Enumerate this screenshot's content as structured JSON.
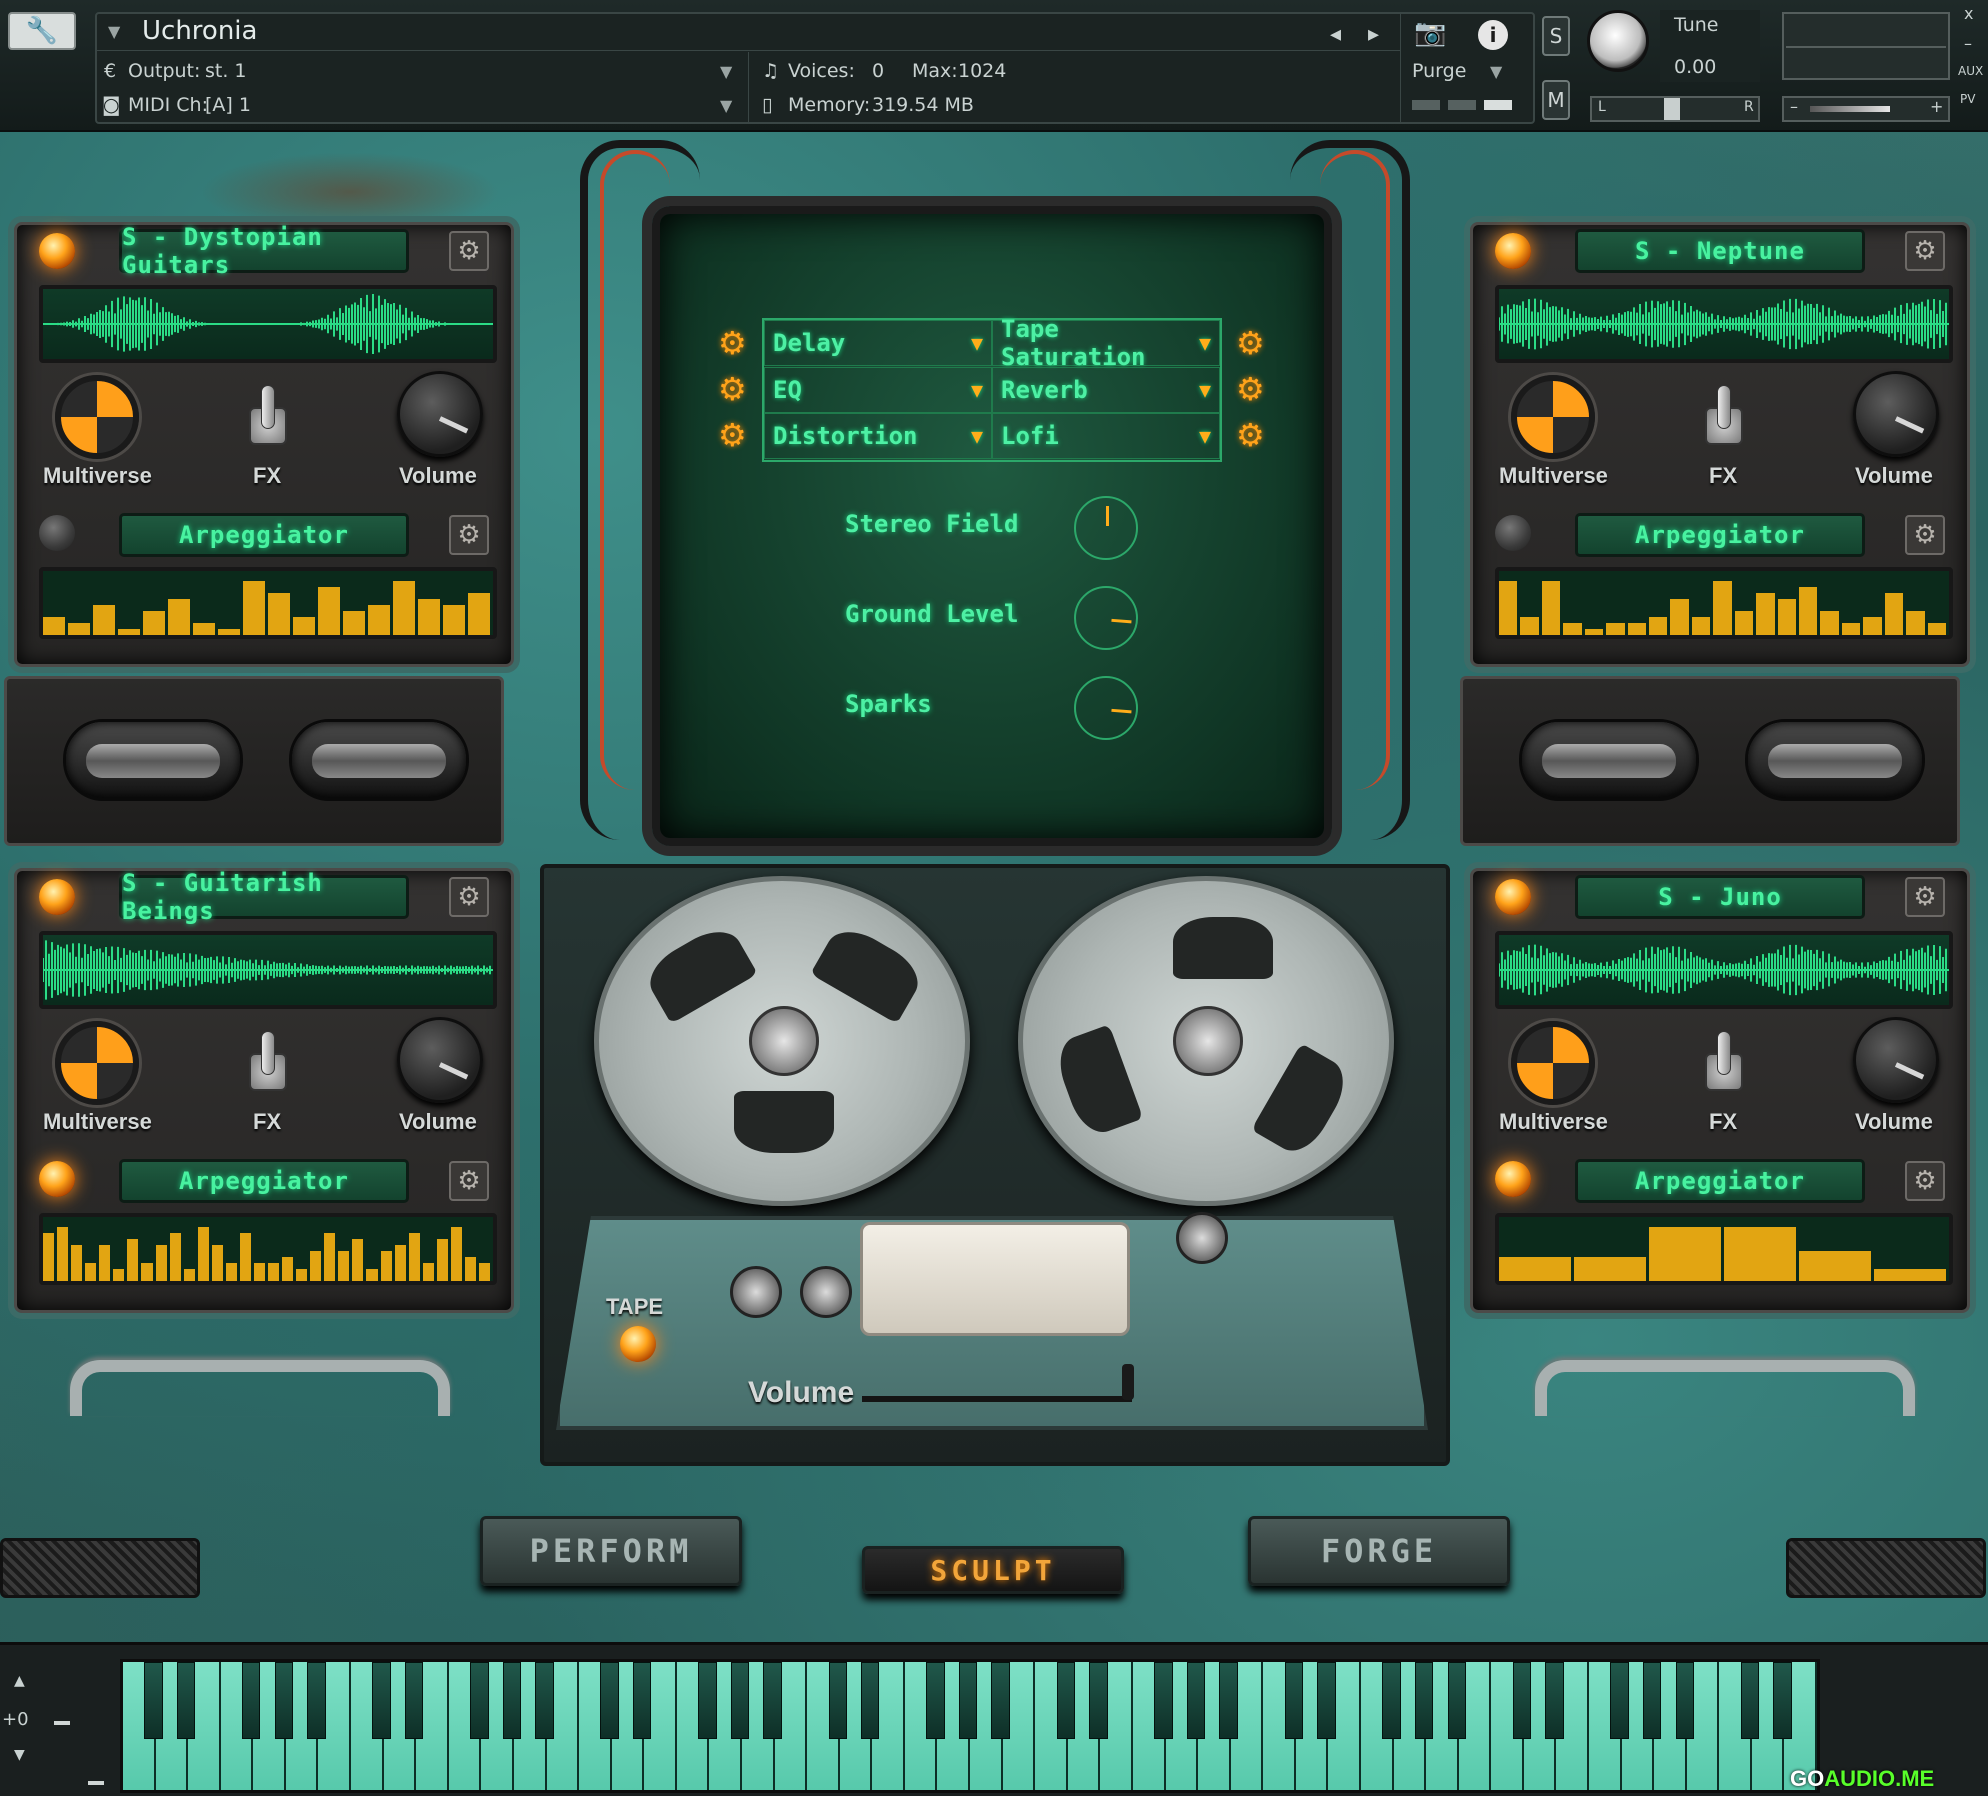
{
  "header": {
    "instrument_title": "Uchronia",
    "output_label": "Output:",
    "output_value": "st. 1",
    "midi_label": "MIDI Ch:",
    "midi_value": "[A]  1",
    "voices_label": "Voices:",
    "voices_value": "0",
    "max_label": "Max:",
    "max_value": "1024",
    "memory_label": "Memory:",
    "memory_value": "319.54 MB",
    "purge_label": "Purge",
    "solo_label": "S",
    "mute_label": "M",
    "tune_label": "Tune",
    "tune_value": "0.00",
    "pan_left": "L",
    "pan_right": "R",
    "aux_label": "AUX",
    "pv_label": "PV",
    "close_label": "x",
    "minimize_label": "–",
    "minus": "–",
    "plus": "+"
  },
  "slots": [
    {
      "name": "S - Dystopian Guitars",
      "multiverse": "Multiverse",
      "fx": "FX",
      "volume": "Volume",
      "arp": "Arpeggiator",
      "led_on": true,
      "arp_led_on": false,
      "arp_bars": [
        0.3,
        0.2,
        0.5,
        0.1,
        0.4,
        0.6,
        0.2,
        0.1,
        0.9,
        0.7,
        0.3,
        0.8,
        0.4,
        0.5,
        0.9,
        0.6,
        0.5,
        0.7
      ]
    },
    {
      "name": "S - Neptune",
      "multiverse": "Multiverse",
      "fx": "FX",
      "volume": "Volume",
      "arp": "Arpeggiator",
      "led_on": true,
      "arp_led_on": false,
      "arp_bars": [
        0.9,
        0.3,
        0.9,
        0.2,
        0.1,
        0.2,
        0.2,
        0.3,
        0.6,
        0.3,
        0.9,
        0.4,
        0.7,
        0.6,
        0.8,
        0.4,
        0.2,
        0.3,
        0.7,
        0.4,
        0.2
      ]
    },
    {
      "name": "S - Guitarish Beings",
      "multiverse": "Multiverse",
      "fx": "FX",
      "volume": "Volume",
      "arp": "Arpeggiator",
      "led_on": true,
      "arp_led_on": true,
      "arp_bars": [
        0.8,
        0.9,
        0.6,
        0.3,
        0.6,
        0.2,
        0.7,
        0.3,
        0.6,
        0.8,
        0.2,
        0.9,
        0.6,
        0.3,
        0.8,
        0.3,
        0.3,
        0.4,
        0.2,
        0.5,
        0.8,
        0.5,
        0.7,
        0.2,
        0.5,
        0.6,
        0.8,
        0.3,
        0.7,
        0.9,
        0.4,
        0.3
      ]
    },
    {
      "name": "S - Juno",
      "multiverse": "Multiverse",
      "fx": "FX",
      "volume": "Volume",
      "arp": "Arpeggiator",
      "led_on": true,
      "arp_led_on": true,
      "arp_bars": [
        0.4,
        0.4,
        0.9,
        0.9,
        0.5,
        0.2
      ]
    }
  ],
  "fx": {
    "left": [
      "Delay",
      "EQ",
      "Distortion"
    ],
    "right": [
      "Tape Saturation",
      "Reverb",
      "Lofi"
    ]
  },
  "screen_knobs": [
    {
      "label": "Stereo Field",
      "value": 0.5
    },
    {
      "label": "Ground Level",
      "value": 0.85
    },
    {
      "label": "Sparks",
      "value": 0.85
    }
  ],
  "deck": {
    "tape_label": "TAPE",
    "volume_label": "Volume"
  },
  "modes": {
    "perform": "PERFORM",
    "sculpt": "SCULPT",
    "forge": "FORGE",
    "active": "SCULPT"
  },
  "keyboard": {
    "octave_value": "+0"
  },
  "watermark": {
    "prefix": "GO",
    "suffix": "AUDIO.ME"
  },
  "colors": {
    "accent": "#ffa31a",
    "lcd_text": "#48f2a0",
    "body": "#356f6b",
    "keys": "#7ee0c6"
  }
}
